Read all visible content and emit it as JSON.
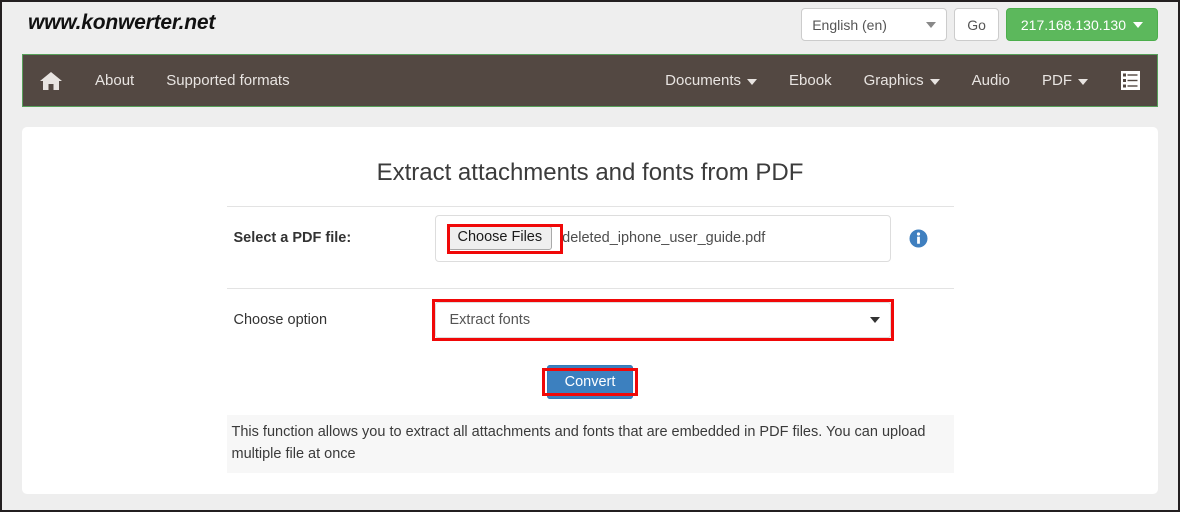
{
  "header": {
    "brand": "www.konwerter.net",
    "language_select": {
      "value": "English (en)",
      "caret": "chevron-down-icon"
    },
    "go_label": "Go",
    "ip_label": "217.168.130.130"
  },
  "nav": {
    "home_icon": "home-icon",
    "list_icon": "list-view-icon",
    "left_items": [
      {
        "label": "About",
        "caret": false
      },
      {
        "label": "Supported formats",
        "caret": false
      }
    ],
    "right_items": [
      {
        "label": "Documents",
        "caret": true
      },
      {
        "label": "Ebook",
        "caret": false
      },
      {
        "label": "Graphics",
        "caret": true
      },
      {
        "label": "Audio",
        "caret": false
      },
      {
        "label": "PDF",
        "caret": true
      }
    ]
  },
  "main": {
    "title": "Extract attachments and fonts from PDF",
    "file_row": {
      "label": "Select a PDF file:",
      "choose_button": "Choose Files",
      "file_name": "deleted_iphone_user_guide.pdf",
      "info_icon": "info-circle-icon"
    },
    "option_row": {
      "label": "Choose option",
      "selected_value": "Extract fonts"
    },
    "convert_label": "Convert",
    "description": "This function allows you to extract all attachments and fonts that are embedded in PDF files. You can upload multiple file at once"
  },
  "colors": {
    "nav_background": "#534842",
    "nav_border": "#57a05a",
    "ip_green": "#5cb85c",
    "convert_blue": "#3c80bf",
    "highlight_red": "#f00808",
    "page_background": "#eeeeee",
    "info_blue": "#3f7fbf"
  }
}
